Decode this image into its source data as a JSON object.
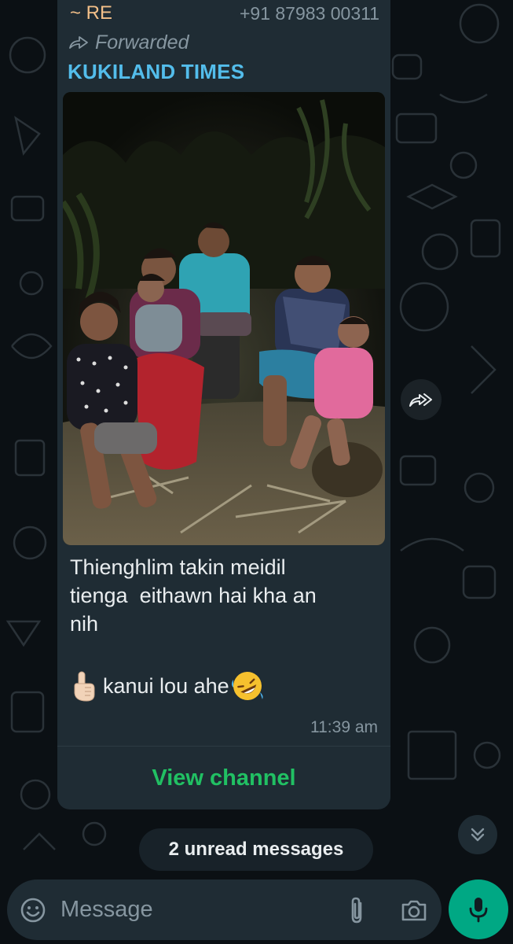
{
  "message": {
    "sender_name": "~ RE",
    "sender_phone": "+91 87983 00311",
    "forwarded_label": "Forwarded",
    "channel_name": "KUKILAND TIMES",
    "caption": "Thienghlim takin meidil\ntienga  eithawn hai kha an\nnih",
    "caption_line2": "kanui lou ahe",
    "timestamp": "11:39 am",
    "view_channel_label": "View channel"
  },
  "unread": {
    "label": "2 unread messages"
  },
  "input": {
    "placeholder": "Message"
  },
  "colors": {
    "accent": "#00a884",
    "view_channel": "#21c063",
    "channel_name": "#53bdeb",
    "sender_name": "#f3c089",
    "bubble": "#1f2c34"
  },
  "icons": {
    "forwarded": "forward-arrow-icon",
    "share": "share-forward-icon",
    "scroll_down": "double-chevron-down-icon",
    "emoji": "emoji-smiley-icon",
    "attach": "paperclip-icon",
    "camera": "camera-icon",
    "mic": "microphone-icon",
    "emoji_hand": "index-pointing-up-emoji",
    "emoji_laugh": "rolling-on-floor-laughing-emoji"
  }
}
